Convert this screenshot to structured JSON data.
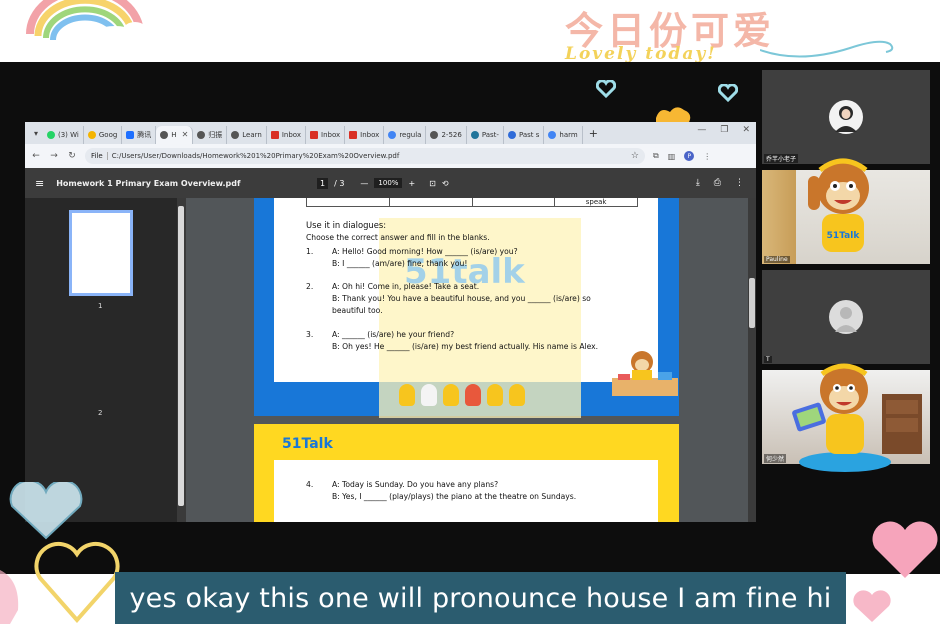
{
  "decoration": {
    "title_cn": "今日份可爱",
    "subtitle": "Lovely today!"
  },
  "browser": {
    "tabs": [
      {
        "label": "(3) Wi",
        "icon": "whatsapp-icon",
        "color": "#25d366"
      },
      {
        "label": "Goog",
        "icon": "google-drive-icon",
        "color": "#f4b400"
      },
      {
        "label": "腾讯",
        "icon": "tencent-docs-icon",
        "color": "#1e6fff"
      },
      {
        "label": "H",
        "icon": "chrome-icon",
        "color": "#555555",
        "active": true
      },
      {
        "label": "归振",
        "icon": "chrome-icon",
        "color": "#555555"
      },
      {
        "label": "Learn",
        "icon": "chrome-icon",
        "color": "#555555"
      },
      {
        "label": "Inbox",
        "icon": "gmail-icon",
        "color": "#d93025"
      },
      {
        "label": "Inbox",
        "icon": "gmail-icon",
        "color": "#d93025"
      },
      {
        "label": "Inbox",
        "icon": "gmail-icon",
        "color": "#d93025"
      },
      {
        "label": "regula",
        "icon": "google-icon",
        "color": "#4285f4"
      },
      {
        "label": "2-526",
        "icon": "chrome-icon",
        "color": "#555555"
      },
      {
        "label": "Past-",
        "icon": "wordpress-icon",
        "color": "#21759b"
      },
      {
        "label": "Past s",
        "icon": "quiz-icon",
        "color": "#2f6bd8"
      },
      {
        "label": "harm",
        "icon": "google-icon",
        "color": "#4285f4"
      }
    ],
    "address": {
      "scheme": "File",
      "url": "C:/Users/User/Downloads/Homework%201%20Primary%20Exam%20Overview.pdf"
    },
    "profile_initial": "P"
  },
  "pdf": {
    "title": "Homework 1 Primary Exam Overview.pdf",
    "page_current": "1",
    "page_total": "/ 3",
    "zoom": "100%",
    "thumbnails": [
      "1",
      "2"
    ],
    "page1": {
      "table_last_cell": "speak",
      "heading": "Use it in dialogues:",
      "instruction": "Choose the correct answer and fill in the blanks.",
      "watermark": "51talk",
      "items": [
        {
          "num": "1.",
          "a": "A: Hello! Good morning! How ______ (is/are) you?",
          "b": "B: I ______ (am/are) fine, thank you!"
        },
        {
          "num": "2.",
          "a": "A: Oh hi! Come in, please! Take a seat.",
          "b": "B: Thank you! You have a beautiful house, and you ______ (is/are) so",
          "c": "beautiful too."
        },
        {
          "num": "3.",
          "a": "A: ______ (is/are) he your friend?",
          "b": "B: Oh yes! He ______ (is/are) my best friend actually. His name is Alex."
        }
      ]
    },
    "page2": {
      "logo": "51Talk",
      "items": [
        {
          "num": "4.",
          "a": "A: Today is Sunday. Do you have any plans?",
          "b": "B: Yes, I ______ (play/plays) the piano at the theatre on Sundays."
        }
      ]
    }
  },
  "participants": [
    {
      "name": "乔芊小老子",
      "type": "avatar"
    },
    {
      "name": "Pauline",
      "type": "camera",
      "badge": "51Talk"
    },
    {
      "name": "T",
      "type": "avatar"
    },
    {
      "name": "何少然",
      "type": "camera"
    }
  ],
  "caption": "yes okay this one will pronounce house I am fine hi",
  "colors": {
    "talk_blue": "#1877d8",
    "talk_yellow": "#ffd821",
    "caption_bg": "#2b5c6f"
  }
}
